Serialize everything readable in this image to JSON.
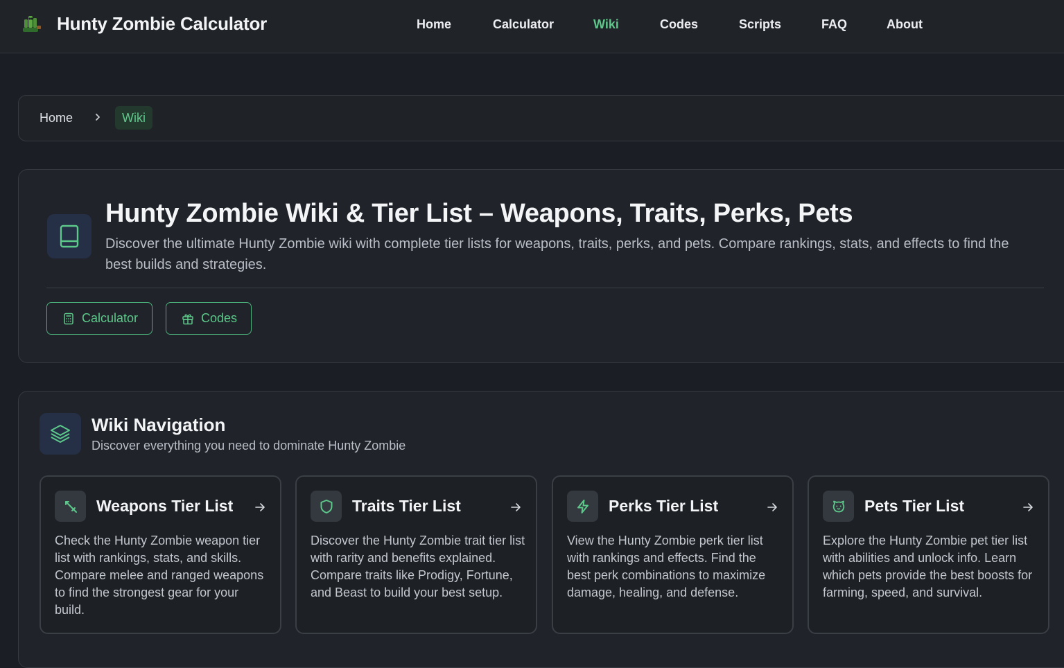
{
  "header": {
    "app_name": "Hunty Zombie Calculator",
    "logo_icon": "zombie-hand-icon",
    "nav": [
      {
        "label": "Home",
        "active": false
      },
      {
        "label": "Calculator",
        "active": false
      },
      {
        "label": "Wiki",
        "active": true
      },
      {
        "label": "Codes",
        "active": false
      },
      {
        "label": "Scripts",
        "active": false
      },
      {
        "label": "FAQ",
        "active": false
      },
      {
        "label": "About",
        "active": false
      }
    ]
  },
  "breadcrumb": {
    "home": "Home",
    "current": "Wiki"
  },
  "hero": {
    "icon": "book-icon",
    "title": "Hunty Zombie Wiki & Tier List – Weapons, Traits, Perks, Pets",
    "description": "Discover the ultimate Hunty Zombie wiki with complete tier lists for weapons, traits, perks, and pets. Compare rankings, stats, and effects to find the best builds and strategies.",
    "buttons": [
      {
        "label": "Calculator",
        "icon": "calculator-icon"
      },
      {
        "label": "Codes",
        "icon": "gift-icon"
      }
    ]
  },
  "wiki_nav": {
    "icon": "layers-icon",
    "title": "Wiki Navigation",
    "subtitle": "Discover everything you need to dominate Hunty Zombie",
    "cards": [
      {
        "title": "Weapons Tier List",
        "icon": "sword-icon",
        "description": "Check the Hunty Zombie weapon tier list with rankings, stats, and skills. Compare melee and ranged weapons to find the strongest gear for your build."
      },
      {
        "title": "Traits Tier List",
        "icon": "shield-icon",
        "description": "Discover the Hunty Zombie trait tier list with rarity and benefits explained. Compare traits like Prodigy, Fortune, and Beast to build your best setup."
      },
      {
        "title": "Perks Tier List",
        "icon": "lightning-icon",
        "description": "View the Hunty Zombie perk tier list with rankings and effects. Find the best perk combinations to maximize damage, healing, and defense."
      },
      {
        "title": "Pets Tier List",
        "icon": "paw-icon",
        "description": "Explore the Hunty Zombie pet tier list with abilities and unlock info. Learn which pets provide the best boosts for farming, speed, and survival."
      }
    ]
  },
  "colors": {
    "background": "#1b1e24",
    "accent": "#5cc98a",
    "panel": "#202329",
    "border": "#363a41"
  }
}
